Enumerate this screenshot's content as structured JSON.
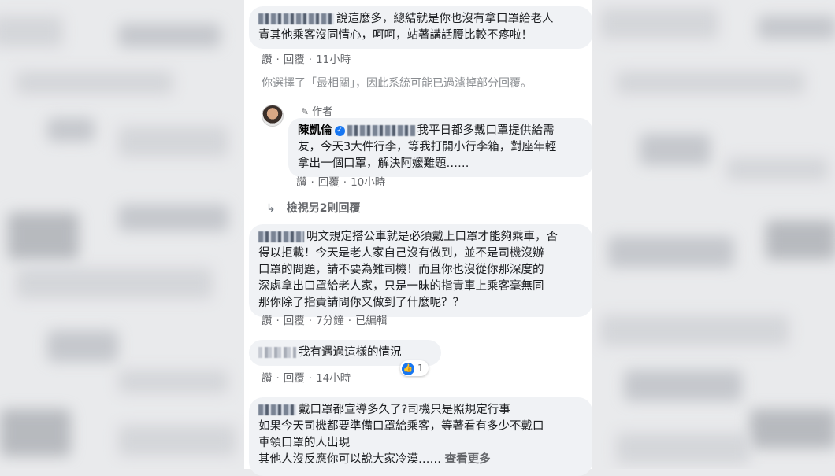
{
  "comments": [
    {
      "lines": [
        "說這麼多，總結就是你也沒有拿口罩給老人",
        "責其他乘客沒同情心，呵呵，站著講話腰比較不疼啦！"
      ],
      "actions": {
        "like": "讚",
        "reply": "回覆",
        "time": "11小時"
      }
    },
    {
      "lines": [
        "明文規定搭公車就是必須戴上口罩才能夠乘車，否",
        "得以拒載！今天是老人家自己沒有做到，並不是司機沒辦",
        "口罩的問題，請不要為難司機！而且你也沒從你那深度的",
        "深處拿出口罩給老人家，只是一昧的指責車上乘客毫無同",
        "那你除了指責請問你又做到了什麼呢？？"
      ],
      "actions": {
        "like": "讚",
        "reply": "回覆",
        "time": "7分鐘",
        "edited": "已編輯"
      }
    },
    {
      "lines": [
        "我有遇過這樣的情況"
      ],
      "actions": {
        "like": "讚",
        "reply": "回覆",
        "time": "14小時"
      },
      "reaction_count": "1"
    },
    {
      "lines": [
        "戴口罩都宣導多久了?司機只是照規定行事",
        "如果今天司機都要準備口罩給乘客，等著看有多少不戴口",
        "車領口罩的人出現",
        "其他人沒反應你可以說大家冷漠……"
      ],
      "see_more": "查看更多"
    }
  ],
  "filter_notice": "你選擇了「最相關」，因此系統可能已過濾掉部分回覆。",
  "author_reply": {
    "badge": "作者",
    "name": "陳凱倫",
    "lines": [
      "我平日都多戴口罩提供給需",
      "友，今天3大件行李，等我打開小行李箱，對座年輕",
      "拿出一個口罩，解決阿嬤難題……"
    ],
    "actions": {
      "like": "讚",
      "reply": "回覆",
      "time": "10小時"
    }
  },
  "view_more_replies": "檢視另2則回覆",
  "icons": {
    "reply_arrow": "reply-arrow-icon",
    "like": "like-reaction-icon",
    "pen": "pencil-icon",
    "verified": "verified-badge-icon"
  },
  "colors": {
    "bubble": "#f0f2f5",
    "meta_text": "#65676b",
    "accent": "#1877f2"
  }
}
